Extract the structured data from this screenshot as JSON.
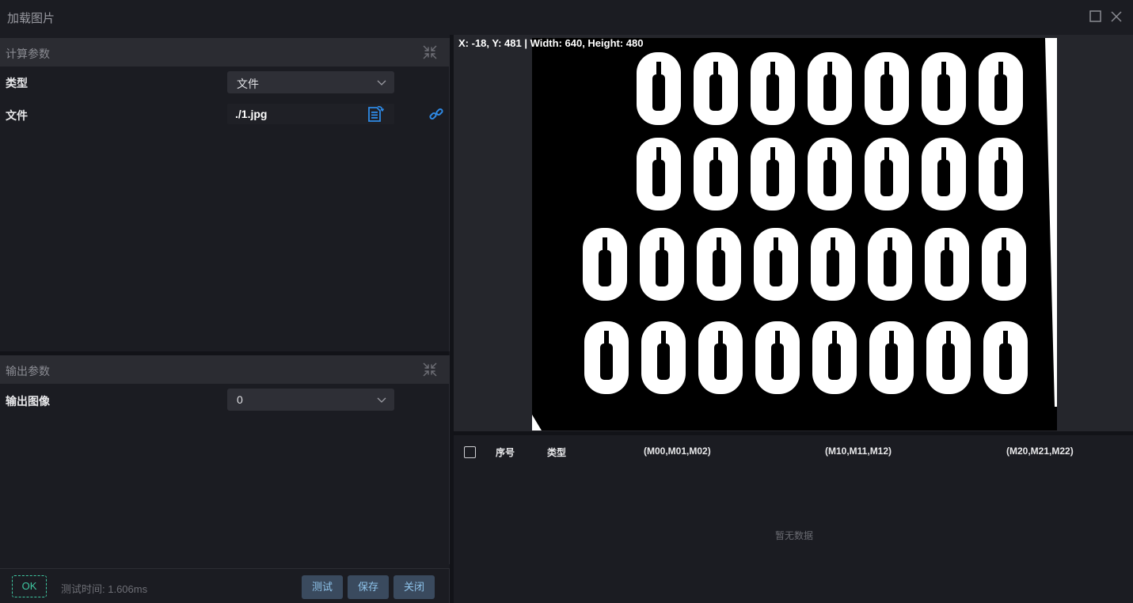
{
  "window": {
    "title": "加载图片"
  },
  "calc_section": {
    "title": "计算参数",
    "type_label": "类型",
    "type_value": "文件",
    "file_label": "文件",
    "file_value": "./1.jpg"
  },
  "output_section": {
    "title": "输出参数",
    "image_label": "输出图像",
    "image_value": "0"
  },
  "footer": {
    "status": "OK",
    "test_time": "测试时间: 1.606ms",
    "test_label": "测试",
    "save_label": "保存",
    "close_label": "关闭"
  },
  "viewer": {
    "coords": "X: -18, Y: 481  |  Width: 640, Height: 480"
  },
  "table": {
    "columns": [
      "序号",
      "类型",
      "(M00,M01,M02)",
      "(M10,M11,M12)",
      "(M20,M21,M22)"
    ],
    "empty_text": "暂无数据"
  },
  "colors": {
    "accent_ok": "#3fc8a2",
    "button_bg": "#3a4a5e",
    "button_text": "#8fc4ec",
    "icon_blue": "#2e8ae6"
  },
  "icons": [
    "maximize-icon",
    "close-icon",
    "collapse-icon",
    "chevron-down-icon",
    "file-select-icon",
    "link-icon",
    "checkbox"
  ]
}
